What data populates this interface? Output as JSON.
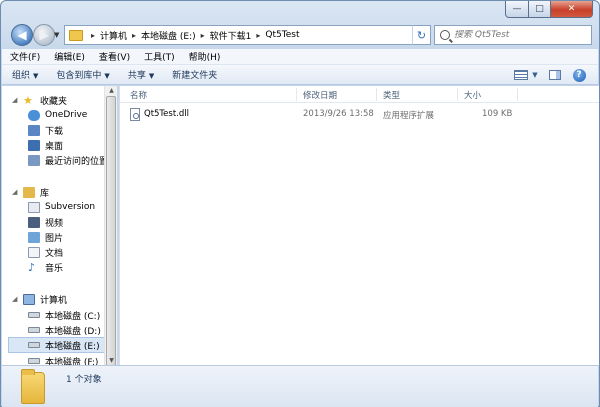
{
  "window": {
    "caption": {
      "minimize": "—",
      "maximize": "□",
      "close": "✕"
    }
  },
  "address": {
    "crumbs": [
      "计算机",
      "本地磁盘 (E:)",
      "软件下载1",
      "Qt5Test"
    ],
    "separator": "▸",
    "refresh": "↻"
  },
  "search": {
    "placeholder": "搜索 Qt5Test"
  },
  "menubar": [
    "文件(F)",
    "编辑(E)",
    "查看(V)",
    "工具(T)",
    "帮助(H)"
  ],
  "toolbar": {
    "organize": "组织",
    "include_in_library": "包含到库中",
    "share": "共享",
    "new_folder": "新建文件夹",
    "help": "?"
  },
  "sidebar": {
    "favorites": {
      "label": "收藏夹",
      "items": [
        "OneDrive",
        "下载",
        "桌面",
        "最近访问的位置"
      ]
    },
    "libraries": {
      "label": "库",
      "items": [
        "Subversion",
        "视频",
        "图片",
        "文档",
        "音乐"
      ]
    },
    "computer": {
      "label": "计算机",
      "items": [
        "本地磁盘 (C:)",
        "本地磁盘 (D:)",
        "本地磁盘 (E:)",
        "本地磁盘 (F:)"
      ]
    }
  },
  "columns": {
    "name": "名称",
    "modified": "修改日期",
    "type": "类型",
    "size": "大小"
  },
  "files": [
    {
      "name": "Qt5Test.dll",
      "modified": "2013/9/26 13:58",
      "type": "应用程序扩展",
      "size": "109 KB",
      "icon": "dll-file-icon"
    }
  ],
  "details": {
    "count": "1 个对象"
  },
  "colors": {
    "accent": "#1e395b",
    "selected": "#d8e6f5"
  }
}
